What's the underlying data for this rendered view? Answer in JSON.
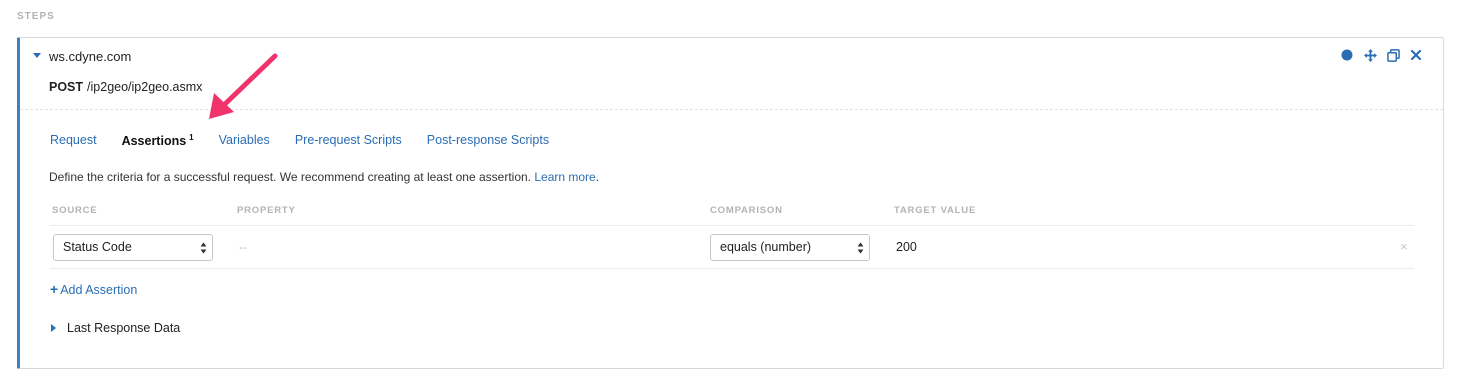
{
  "section": {
    "label": "STEPS"
  },
  "step": {
    "host": "ws.cdyne.com",
    "method": "POST",
    "path": "/ip2geo/ip2geo.asmx",
    "toolbar_icons": [
      "status-dot-icon",
      "move-icon",
      "duplicate-icon",
      "close-icon"
    ]
  },
  "tabs": [
    {
      "label": "Request"
    },
    {
      "label": "Assertions",
      "badge": "1",
      "active": true
    },
    {
      "label": "Variables"
    },
    {
      "label": "Pre-request Scripts"
    },
    {
      "label": "Post-response Scripts"
    }
  ],
  "assertions": {
    "description": "Define the criteria for a successful request. We recommend creating at least one assertion.",
    "learn_more": "Learn more",
    "learn_more_suffix": ".",
    "columns": {
      "source": "SOURCE",
      "property": "PROPERTY",
      "comparison": "COMPARISON",
      "target": "TARGET VALUE"
    },
    "rows": [
      {
        "source": "Status Code",
        "property": "--",
        "comparison": "equals (number)",
        "target": "200",
        "remove": "×"
      }
    ],
    "add_label": "Add Assertion",
    "add_plus": "+"
  },
  "last_response": {
    "label": "Last Response Data"
  },
  "colors": {
    "accent": "#2a6db3",
    "border_accent": "#3b82c4",
    "annotation_arrow": "#f0336b"
  }
}
